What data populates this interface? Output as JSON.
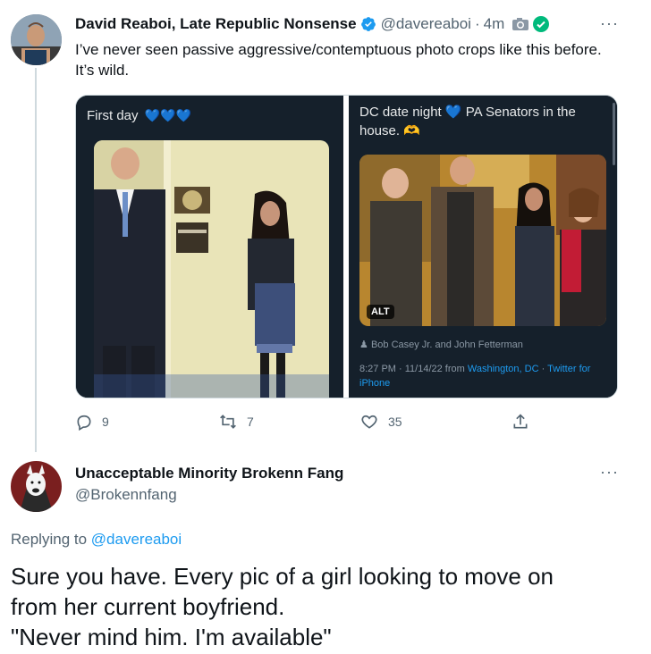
{
  "tweet1": {
    "author_name": "David Reaboi, Late Republic Nonsense",
    "handle": "@davereaboi",
    "separator": "·",
    "time": "4m",
    "more": "···",
    "text": "I’ve never seen passive aggressive/contemptuous photo crops like this before. It’s wild.",
    "quote_left": {
      "caption": "First day",
      "hearts": "💙💙💙"
    },
    "quote_right": {
      "caption": "DC date night 💙 PA Senators in the house. 🫶",
      "alt_badge": "ALT",
      "tagged": "Bob Casey Jr. and John Fetterman",
      "meta_time": "8:27 PM · 11/14/22 from ",
      "meta_location": "Washington, DC",
      "meta_sep": " · ",
      "meta_client": "Twitter for iPhone"
    },
    "actions": {
      "replies": "9",
      "retweets": "7",
      "likes": "35"
    }
  },
  "tweet2": {
    "author_name": "Unacceptable Minority Brokenn Fang",
    "handle": "@Brokennfang",
    "more": "···",
    "replying_prefix": "Replying to ",
    "replying_to": "@davereaboi",
    "text_line1": "Sure you have. Every pic of a girl looking to move on",
    "text_line2": "from her current boyfriend.",
    "text_line3": "\"Never mind him. I'm available\""
  },
  "colors": {
    "accent": "#1d9bf0",
    "secondary_text": "#536471",
    "primary_text": "#0f1419",
    "verified_badge": "#1d9bf0",
    "check_badge": "#00ba7c",
    "media_bg": "#15202b"
  }
}
